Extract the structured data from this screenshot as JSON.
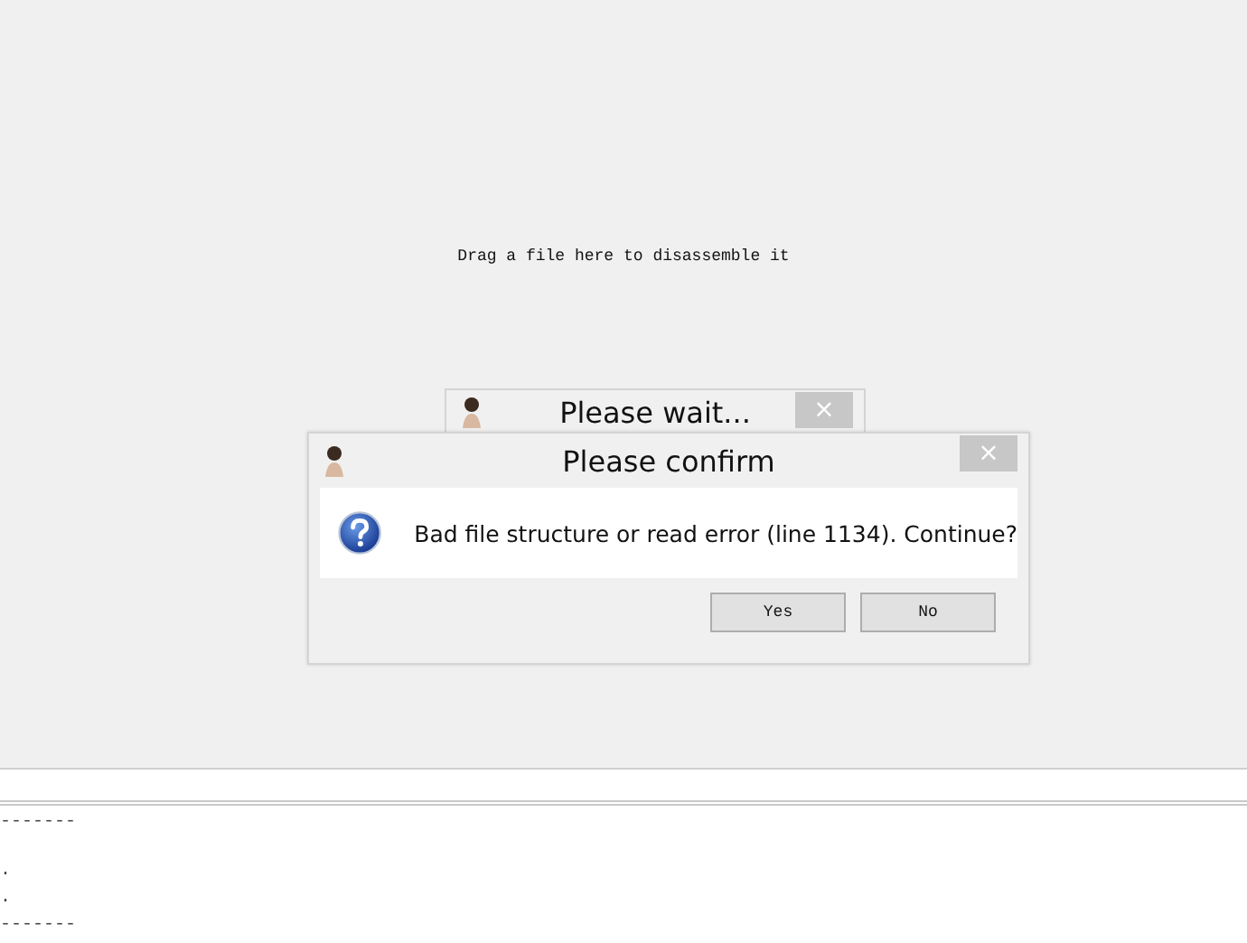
{
  "workspace": {
    "hint": "Drag a file here to disassemble it"
  },
  "wait_dialog": {
    "title": "Please wait...",
    "close": "×"
  },
  "confirm_dialog": {
    "title": "Please confirm",
    "close": "×",
    "message": "Bad file structure or read error (line 1134). Continue?",
    "buttons": [
      "Yes",
      "No"
    ]
  },
  "output": {
    "lines": [
      "-------",
      ".",
      ".",
      "-------"
    ]
  }
}
